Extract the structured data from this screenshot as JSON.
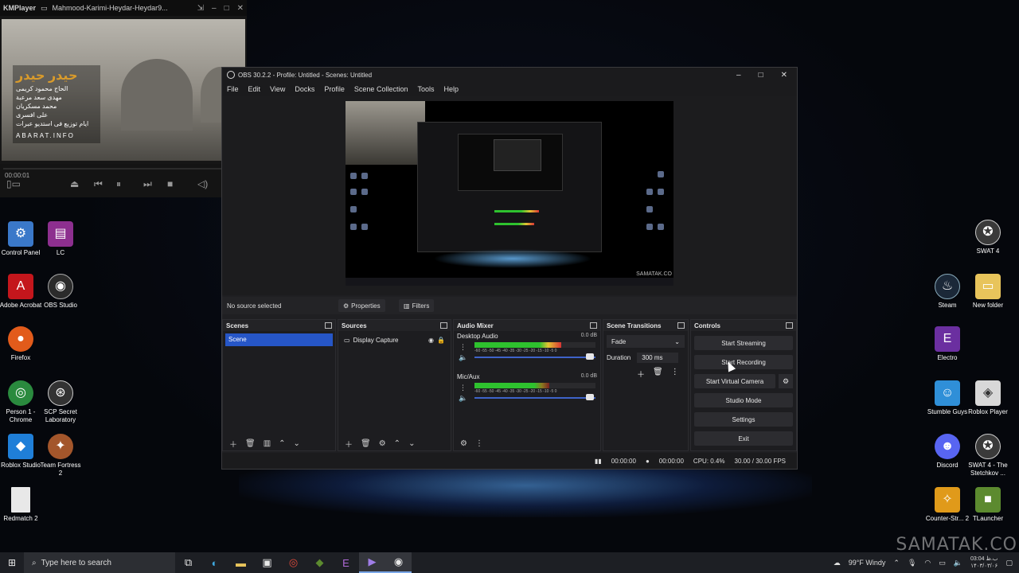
{
  "kmplayer": {
    "app_name": "KMPlayer",
    "file_title": "Mahmood-Karimi-Heydar-Heydar9...",
    "time": "00:00:01",
    "overlay_title": "حیدر حیدر",
    "overlay_lines": [
      "الحاج محمود کریمی",
      "مهدی سعد مرعبة",
      "محمد مسکریان",
      "علی افسری",
      "ایام توزیع فی استدیو عبرات"
    ],
    "overlay_site": "ABARAT.INFO"
  },
  "desktop_left": [
    {
      "label": "Control Panel",
      "icon": "control-panel-icon",
      "color": "#3a78c9",
      "glyph": "⚙"
    },
    {
      "label": "LC",
      "icon": "winrar-icon",
      "color": "#8d2f8f",
      "glyph": "▤"
    },
    {
      "label": "Adobe Acrobat",
      "icon": "acrobat-icon",
      "color": "#c4161c",
      "glyph": "A"
    },
    {
      "label": "OBS Studio",
      "icon": "obs-icon",
      "color": "#2b2b2b",
      "glyph": "◉"
    },
    {
      "label": "Firefox",
      "icon": "firefox-icon",
      "color": "#e25b1b",
      "glyph": "●"
    },
    {
      "label": "Person 1 - Chrome",
      "icon": "chrome-icon",
      "color": "#2a8a3e",
      "glyph": "◎"
    },
    {
      "label": "SCP Secret Laboratory",
      "icon": "scp-icon",
      "color": "#333333",
      "glyph": "⊛"
    },
    {
      "label": "Roblox Studio",
      "icon": "roblox-studio-icon",
      "color": "#1f7fd8",
      "glyph": "◆"
    },
    {
      "label": "Team Fortress 2",
      "icon": "tf2-icon",
      "color": "#a3562b",
      "glyph": "✦"
    },
    {
      "label": "Redmatch 2",
      "icon": "file-icon",
      "color": "#e8e8e8",
      "glyph": ""
    }
  ],
  "desktop_right": [
    {
      "label": "SWAT 4",
      "icon": "swat4-icon",
      "color": "#3a3a3a",
      "glyph": "✪"
    },
    {
      "label": "Steam",
      "icon": "steam-icon",
      "color": "#1b2838",
      "glyph": "♨"
    },
    {
      "label": "New folder",
      "icon": "folder-icon",
      "color": "#e8c45b",
      "glyph": "▭"
    },
    {
      "label": "Electro",
      "icon": "electro-icon",
      "color": "#6b2fa0",
      "glyph": "E"
    },
    {
      "label": "Stumble Guys",
      "icon": "stumble-guys-icon",
      "color": "#2f8fd8",
      "glyph": "☺"
    },
    {
      "label": "Roblox Player",
      "icon": "roblox-player-icon",
      "color": "#d8d8d8",
      "glyph": "◈"
    },
    {
      "label": "Discord",
      "icon": "discord-icon",
      "color": "#5865f2",
      "glyph": "☻"
    },
    {
      "label": "SWAT 4 - The Stetchkov ...",
      "icon": "swat4-expansion-icon",
      "color": "#3a3a3a",
      "glyph": "✪"
    },
    {
      "label": "Counter-Str... 2",
      "icon": "counter-strike-icon",
      "color": "#e09a1a",
      "glyph": "✧"
    },
    {
      "label": "TLauncher",
      "icon": "tlauncher-icon",
      "color": "#5c8a2f",
      "glyph": "■"
    }
  ],
  "obs": {
    "title": "OBS 30.2.2 - Profile: Untitled - Scenes: Untitled",
    "menu": [
      "File",
      "Edit",
      "View",
      "Docks",
      "Profile",
      "Scene Collection",
      "Tools",
      "Help"
    ],
    "preview_watermark": "SAMATAK.CO",
    "source_bar": {
      "no_source": "No source selected",
      "properties": "Properties",
      "filters": "Filters"
    },
    "docks": {
      "scenes": {
        "title": "Scenes",
        "items": [
          "Scene"
        ]
      },
      "sources": {
        "title": "Sources",
        "items": [
          "Display Capture"
        ]
      },
      "mixer": {
        "title": "Audio Mixer",
        "channels": [
          {
            "name": "Desktop Audio",
            "db": "0.0 dB",
            "level": 0.72,
            "scale": "-60 -55 -50 -45 -40 -35 -30 -25 -20 -15 -10 -5 0"
          },
          {
            "name": "Mic/Aux",
            "db": "0.0 dB",
            "level": 0.62,
            "scale": "-60 -55 -50 -45 -40 -35 -30 -25 -20 -15 -10 -5 0"
          }
        ]
      },
      "transitions": {
        "title": "Scene Transitions",
        "selected": "Fade",
        "duration_label": "Duration",
        "duration_value": "300 ms"
      },
      "controls": {
        "title": "Controls",
        "start_streaming": "Start Streaming",
        "start_recording": "Start Recording",
        "start_virtual_camera": "Start Virtual Camera",
        "studio_mode": "Studio Mode",
        "settings": "Settings",
        "exit": "Exit"
      }
    },
    "status": {
      "stream_time": "00:00:00",
      "rec_time": "00:00:00",
      "cpu": "CPU: 0.4%",
      "fps": "30.00 / 30.00 FPS"
    }
  },
  "watermark": "SAMATAK.CO",
  "taskbar": {
    "search_placeholder": "Type here to search",
    "weather": "99°F Windy",
    "clock_time": "03:04 ب.ظ",
    "clock_date": "۱۴۰۳/۰۳/۰۶"
  }
}
